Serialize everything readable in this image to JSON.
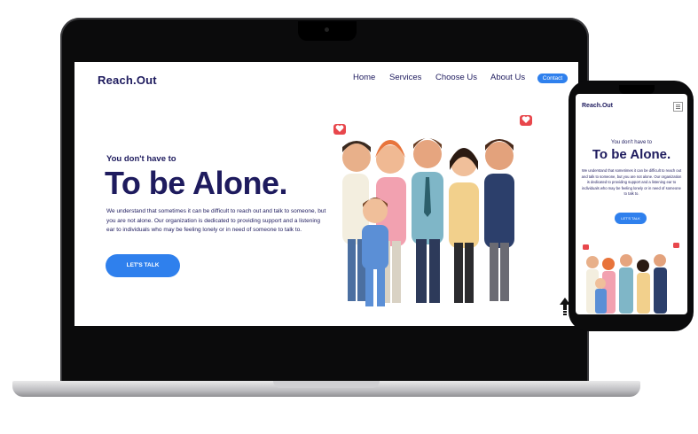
{
  "laptop_site": {
    "brand": "Reach.Out",
    "nav": [
      "Home",
      "Services",
      "Choose Us",
      "About Us"
    ],
    "contact_label": "Contact",
    "tagline": "You don't have to",
    "hero_title": "To be Alone.",
    "description": "We understand that sometimes it can be difficult to reach out and talk to someone, but you are not alone. Our organization is dedicated to providing support and a listening ear to individuals who may be feeling lonely or in need of someone to talk to.",
    "cta_label": "LET'S TALK"
  },
  "phone_site": {
    "brand": "Reach.Out",
    "tagline": "You don't have to",
    "hero_title": "To be Alone.",
    "description": "We understand that sometimes it can be difficult to reach out and talk to someone, but you are not alone. Our organization is dedicated to providing support and a listening ear to individuals who may be feeling lonely or in need of someone to talk to.",
    "cta_label": "LET'S TALK"
  },
  "colors": {
    "brand_navy": "#1e1b5e",
    "accent_blue": "#2f80ed",
    "heart_red": "#e8474c"
  },
  "icons": [
    "heart-icon",
    "menu-icon",
    "arrow-up-icon"
  ]
}
